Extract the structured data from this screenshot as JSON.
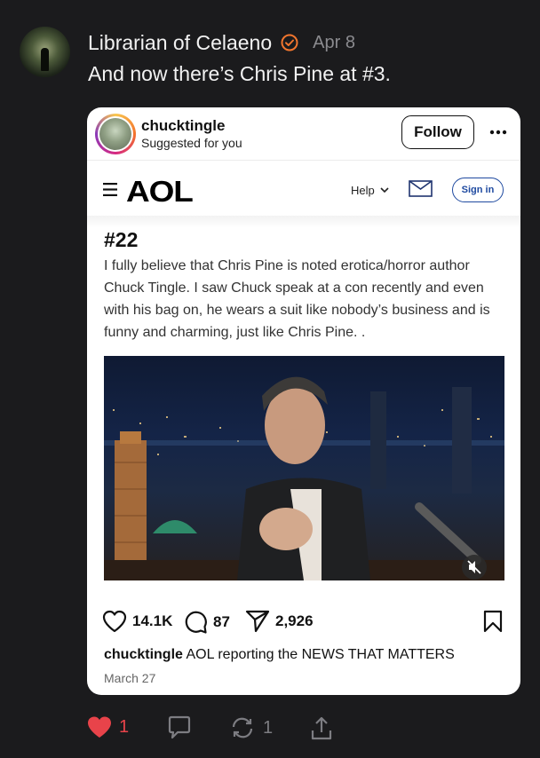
{
  "post": {
    "author": "Librarian of Celaeno",
    "date": "Apr 8",
    "text": "And now there’s Chris Pine at #3."
  },
  "embed": {
    "username": "chucktingle",
    "suggested": "Suggested for you",
    "follow_label": "Follow",
    "aol": {
      "logo": "AOL",
      "help_label": "Help",
      "signin_label": "Sign in"
    },
    "article": {
      "number": "#22",
      "body": "I fully believe that Chris Pine is noted erotica/horror author Chuck Tingle. I saw Chuck speak at a con recently and even with his bag on, he wears a suit like nobody’s business and is funny and charming, just like Chris Pine. ."
    },
    "likes": "14.1K",
    "comments": "87",
    "shares": "2,926",
    "caption_user": "chucktingle",
    "caption_text": "AOL reporting the NEWS THAT MATTERS",
    "post_date": "March 27"
  },
  "actions": {
    "like_count": "1",
    "reblog_count": "1"
  },
  "colors": {
    "background": "#1b1b1d",
    "accent_orange": "#f2762e",
    "heart_red": "#e8434a",
    "aol_blue": "#1f4aa0"
  }
}
